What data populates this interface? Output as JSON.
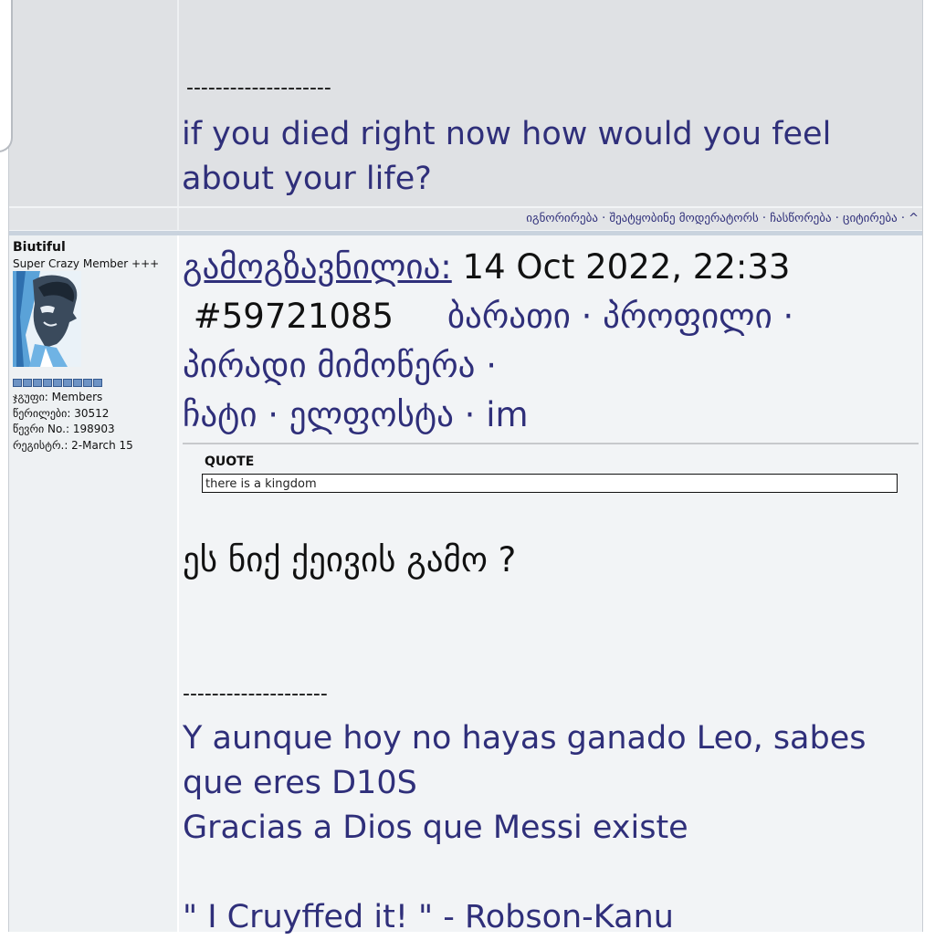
{
  "previous_post": {
    "signature_divider": "--------------------",
    "signature_text": "if you died right now how would you feel about your life?"
  },
  "post_actions": {
    "ignore": "იგნორირება",
    "report": "შეატყობინე მოდერატორს",
    "edit": "ჩასწორება",
    "quote": "ციტირება",
    "separator": " · ",
    "top": "^"
  },
  "post": {
    "author": {
      "name": "Biutiful",
      "title": "Super Crazy Member +++",
      "group": "ჯგუფი: Members",
      "posts": "წერილები: 30512",
      "member_no": "წევრი No.: 198903",
      "registered": "რეგისტრ.: 2-March 15"
    },
    "header": {
      "sent_label": "გამოგზავნილია:",
      "date": "14 Oct 2022, 22:33",
      "post_number": "#59721085",
      "card": "ბარათი",
      "profile": "პროფილი",
      "pm": "პირადი მიმოწერა",
      "chat": "ჩატი",
      "email": "ელფოსტა",
      "im": "im",
      "dot": "·"
    },
    "quote": {
      "label": "QUOTE",
      "text": "there is a kingdom"
    },
    "body": "ეს ნიქ ქეივის გამო ?",
    "signature_divider": "--------------------",
    "signature_lines": [
      "Y aunque hoy no hayas ganado Leo, sabes que eres D10S",
      "Gracias a Dios que Messi existe",
      "\" I Cruyffed it! \" - Robson-Kanu"
    ]
  },
  "colors": {
    "link": "#2f2f7a",
    "header_bg": "#dfe1e4",
    "post_bg": "#f2f4f6",
    "pip": "#6d93c4"
  }
}
